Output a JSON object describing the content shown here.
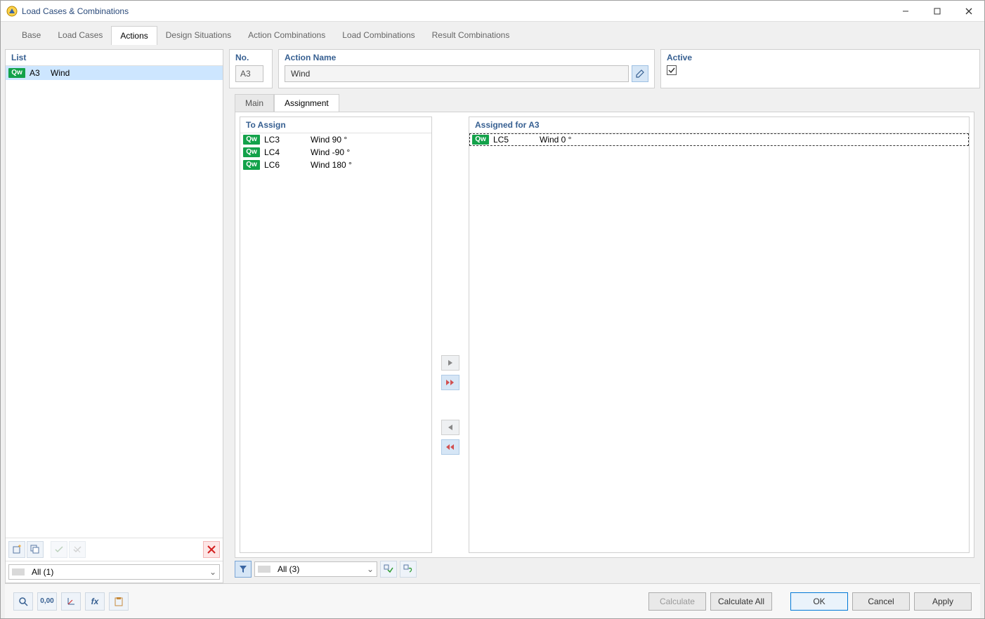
{
  "window": {
    "title": "Load Cases & Combinations"
  },
  "tabs": {
    "items": [
      "Base",
      "Load Cases",
      "Actions",
      "Design Situations",
      "Action Combinations",
      "Load Combinations",
      "Result Combinations"
    ],
    "active_index": 2
  },
  "left": {
    "header": "List",
    "items": [
      {
        "badge": "Qw",
        "code": "A3",
        "name": "Wind",
        "selected": true
      }
    ],
    "filter_label": "All (1)"
  },
  "detail": {
    "no_label": "No.",
    "no_value": "A3",
    "name_label": "Action Name",
    "name_value": "Wind",
    "active_label": "Active",
    "active_checked": true
  },
  "sub_tabs": {
    "items": [
      "Main",
      "Assignment"
    ],
    "active_index": 1
  },
  "assign": {
    "left_header": "To Assign",
    "right_header": "Assigned for A3",
    "to_assign": [
      {
        "badge": "Qw",
        "code": "LC3",
        "name": "Wind 90 °"
      },
      {
        "badge": "Qw",
        "code": "LC4",
        "name": "Wind -90 °"
      },
      {
        "badge": "Qw",
        "code": "LC6",
        "name": "Wind 180 °"
      }
    ],
    "assigned": [
      {
        "badge": "Qw",
        "code": "LC5",
        "name": "Wind 0 °",
        "selected": true
      }
    ],
    "filter_label": "All (3)"
  },
  "buttons": {
    "calculate": "Calculate",
    "calculate_all": "Calculate All",
    "ok": "OK",
    "cancel": "Cancel",
    "apply": "Apply"
  },
  "icons": {
    "badge_text": "Qw"
  },
  "footer_icons": [
    "search",
    "decimals",
    "tree",
    "fx",
    "clipboard"
  ]
}
